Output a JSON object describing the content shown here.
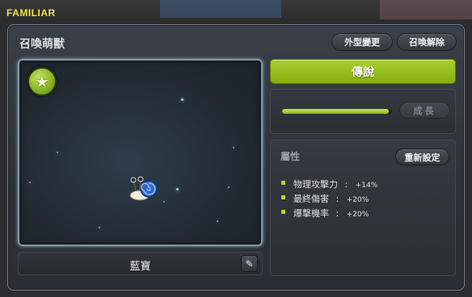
{
  "window": {
    "title": "FAMILIAR"
  },
  "panel": {
    "title": "召喚萌獸"
  },
  "buttons": {
    "appearance_label": "外型變更",
    "dismiss_label": "召喚解除",
    "reset_label": "重新設定"
  },
  "familiar": {
    "name": "藍寶",
    "rarity_label": "傳說",
    "growth_label": "成長",
    "growth_fraction": 0.97
  },
  "attributes": {
    "title": "屬性",
    "items": [
      {
        "name": "物理攻擊力",
        "sep": ":",
        "value": "+14%"
      },
      {
        "name": "最終傷害",
        "sep": ":",
        "value": "+20%"
      },
      {
        "name": "爆擊機率",
        "sep": ":",
        "value": "+20%"
      }
    ]
  },
  "icons": {
    "star_badge": "star-badge-icon",
    "edit": "pencil-icon"
  },
  "colors": {
    "title": "#f2e24a",
    "rarity_green": "#96bd1c",
    "bullet": "#b6d62a"
  }
}
